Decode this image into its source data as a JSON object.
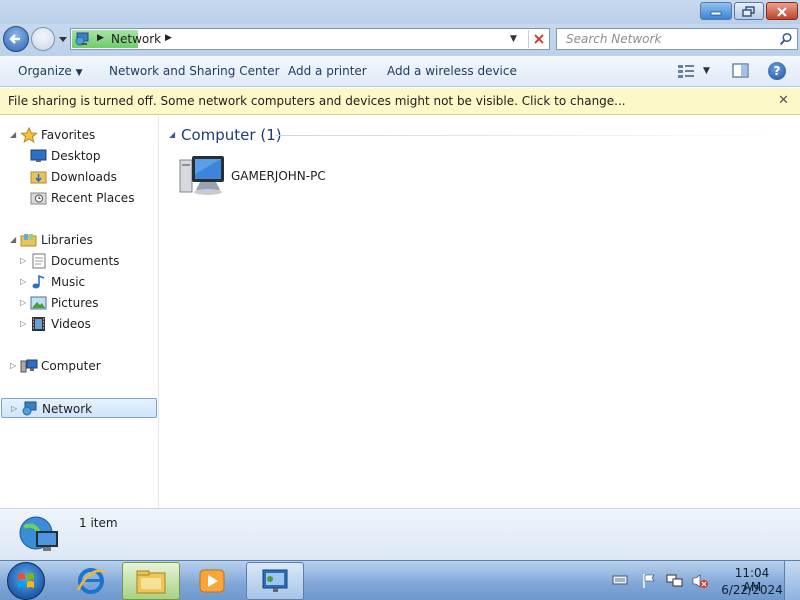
{
  "window": {
    "controls": [
      "minimize-icon",
      "restore-icon",
      "close-icon"
    ]
  },
  "navigation": {
    "address_segment": "Network",
    "search_placeholder": "Search Network"
  },
  "toolbar": {
    "organize": "Organize",
    "network_sharing_center": "Network and Sharing Center",
    "add_printer": "Add a printer",
    "add_wireless": "Add a wireless device"
  },
  "infobar": {
    "message": "File sharing is turned off. Some network computers and devices might not be visible. Click to change..."
  },
  "sidebar": {
    "favorites": {
      "label": "Favorites",
      "items": [
        {
          "label": "Desktop",
          "icon": "desktop-icon"
        },
        {
          "label": "Downloads",
          "icon": "downloads-folder-icon"
        },
        {
          "label": "Recent Places",
          "icon": "recent-places-icon"
        }
      ]
    },
    "libraries": {
      "label": "Libraries",
      "items": [
        {
          "label": "Documents",
          "icon": "documents-icon"
        },
        {
          "label": "Music",
          "icon": "music-icon"
        },
        {
          "label": "Pictures",
          "icon": "pictures-icon"
        },
        {
          "label": "Videos",
          "icon": "videos-icon"
        }
      ]
    },
    "computer": {
      "label": "Computer"
    },
    "network": {
      "label": "Network",
      "selected": true
    }
  },
  "content": {
    "group_title": "Computer (1)",
    "items": [
      {
        "label": "GAMERJOHN-PC",
        "icon": "computer-icon"
      }
    ]
  },
  "details": {
    "count": "1 item"
  },
  "taskbar": {
    "apps": [
      "internet-explorer-icon",
      "windows-explorer-icon",
      "windows-media-player-icon",
      "network-icon"
    ],
    "clock": {
      "time": "11:04 AM",
      "date": "6/22/2024"
    }
  },
  "colors": {
    "selection": "#d0e4fa",
    "infobar": "#fdf8c7",
    "address_highlight": "#6fcb6c",
    "group_title": "#1e3c78"
  }
}
